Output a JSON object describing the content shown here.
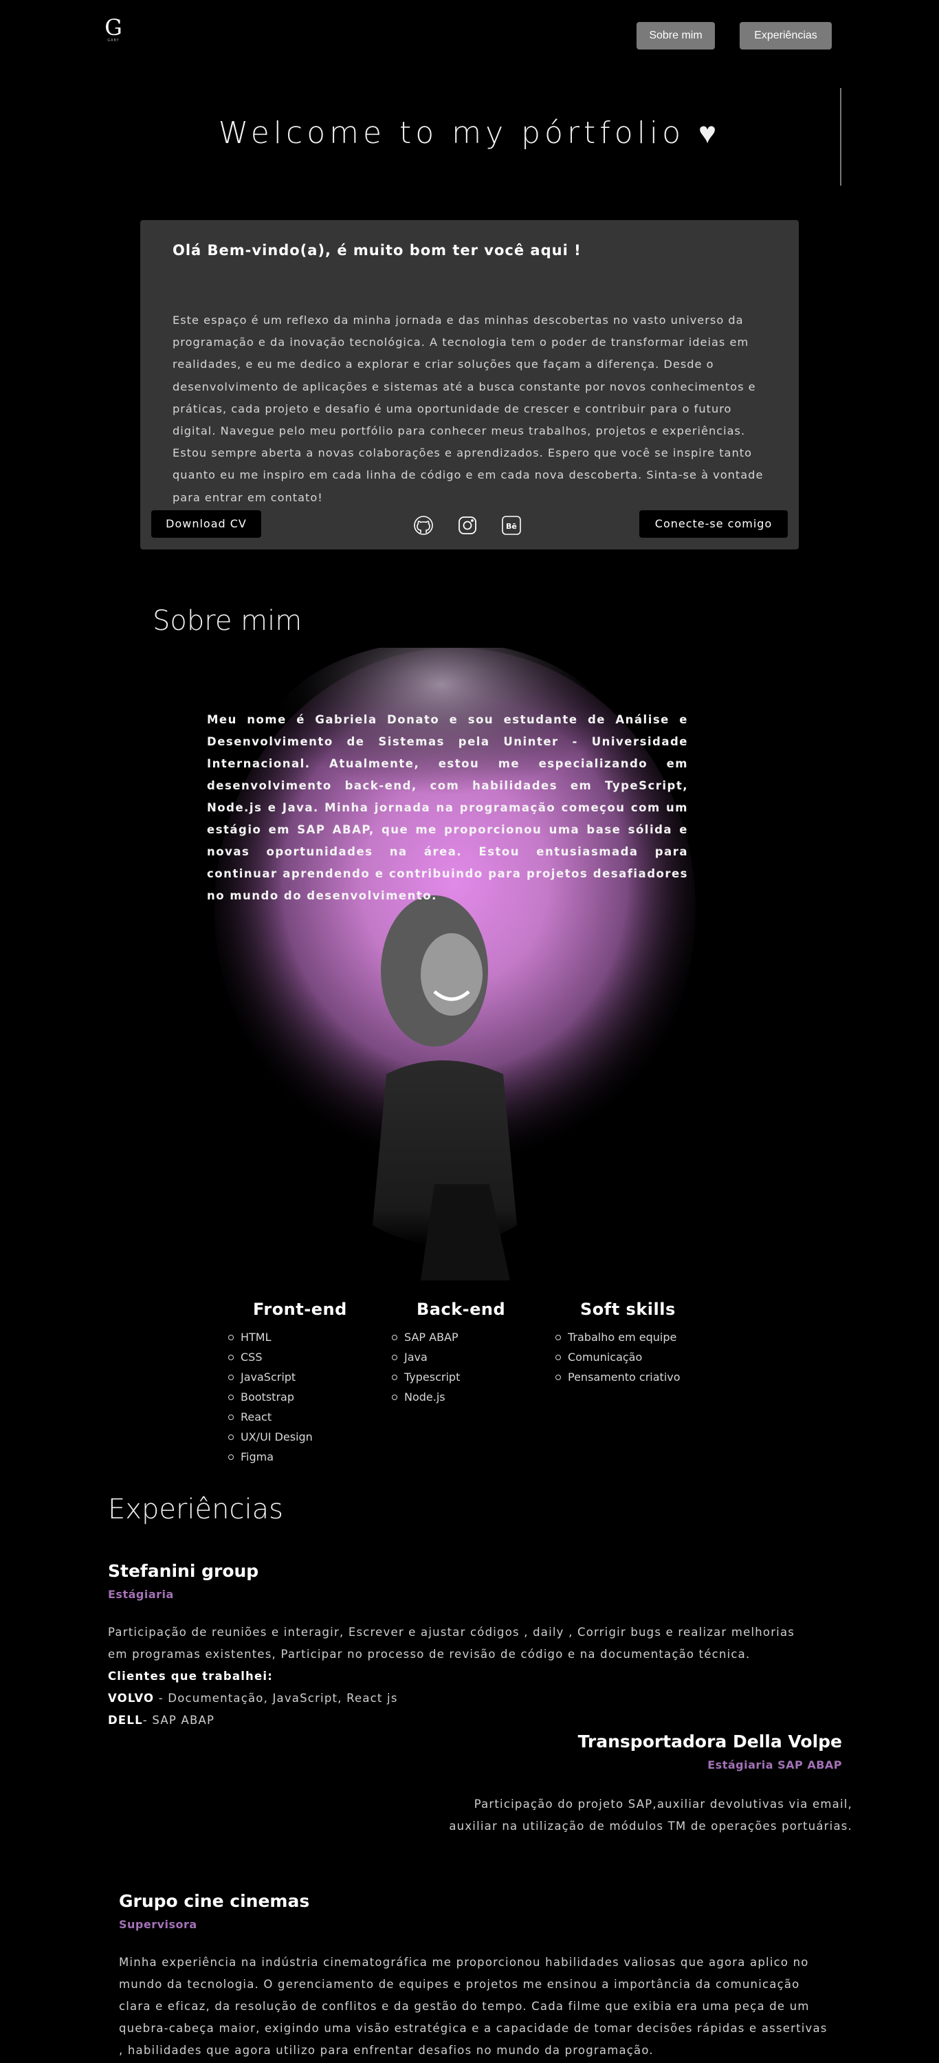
{
  "header": {
    "logo_letter": "G",
    "logo_sub": "GABY",
    "nav": [
      "Sobre mim",
      "Experiências"
    ]
  },
  "welcome": "Welcome to my pórtfolio ♥",
  "intro_card": {
    "title": "Olá Bem-vindo(a), é muito bom ter você aqui !",
    "text": "Este espaço é um reflexo da minha jornada e das minhas descobertas no vasto universo da programação e da inovação tecnológica. A tecnologia tem o poder de transformar ideias em realidades, e eu me dedico a explorar e criar soluções que façam a diferença. Desde o desenvolvimento de aplicações e sistemas até a busca constante por novos conhecimentos e práticas, cada projeto e desafio é uma oportunidade de crescer e contribuir para o futuro digital. Navegue pelo meu portfólio para conhecer meus trabalhos, projetos e experiências. Estou sempre aberta a novas colaborações e aprendizados. Espero que você se inspire tanto quanto eu me inspiro em cada linha de código e em cada nova descoberta. Sinta-se à vontade para entrar em contato!",
    "download_cv": "Download CV",
    "connect": "Conecte-se comigo",
    "social_icons": [
      "github-icon",
      "instagram-icon",
      "behance-icon"
    ]
  },
  "about": {
    "title": "Sobre mim",
    "text": "Meu nome é Gabriela Donato e sou estudante de Análise e Desenvolvimento de Sistemas pela Uninter - Universidade Internacional. Atualmente, estou me especializando em desenvolvimento back-end, com habilidades em TypeScript, Node.js e Java. Minha jornada na programação começou com um estágio em SAP ABAP, que me proporcionou uma base sólida e novas oportunidades na área. Estou entusiasmada para continuar aprendendo e contribuindo para projetos desafiadores no mundo do desenvolvimento."
  },
  "skills": {
    "frontend": {
      "title": "Front-end",
      "items": [
        "HTML",
        "CSS",
        "JavaScript",
        "Bootstrap",
        "React",
        "UX/UI Design",
        "Figma"
      ]
    },
    "backend": {
      "title": "Back-end",
      "items": [
        "SAP ABAP",
        "Java",
        "Typescript",
        "Node.js"
      ]
    },
    "soft": {
      "title": "Soft skills",
      "items": [
        "Trabalho em equipe",
        "Comunicação",
        "Pensamento criativo"
      ]
    }
  },
  "experiences": {
    "title": "Experiências",
    "jobs": [
      {
        "company": "Stefanini group",
        "role": "Estágiaria",
        "description": "Participação de reuniões e interagir, Escrever e ajustar códigos , daily , Corrigir bugs e realizar melhorias em programas existentes, Participar no processo de revisão de código e na documentação técnica.",
        "clients_label": "Clientes que trabalhei:",
        "client1_name": "VOLVO",
        "client1_desc": " - Documentação, JavaScript, React js",
        "client2_name": "DELL",
        "client2_desc": "- SAP ABAP"
      },
      {
        "company": "Transportadora Della Volpe",
        "role": "Estágiaria SAP ABAP",
        "description_line1": "Participação do projeto SAP,auxiliar devolutivas via email,",
        "description_line2": "auxiliar na utilização de módulos TM de operações portuárias."
      },
      {
        "company": "Grupo cine cinemas",
        "role": "Supervisora",
        "description": "Minha experiência na indústria cinematográfica me proporcionou habilidades valiosas que agora aplico no mundo da tecnologia. O gerenciamento de equipes e projetos me ensinou a importância da comunicação clara e eficaz, da resolução de conflitos e da gestão do tempo. Cada filme que exibia era uma peça de um quebra-cabeça maior, exigindo uma visão estratégica e a capacidade de tomar decisões rápidas e assertivas , habilidades que agora utilizo para enfrentar desafios no mundo da programação."
      }
    ]
  },
  "colors": {
    "background": "#000000",
    "card": "#363636",
    "accent_purple": "#a472b8",
    "nav_button": "#7a7a7a"
  }
}
